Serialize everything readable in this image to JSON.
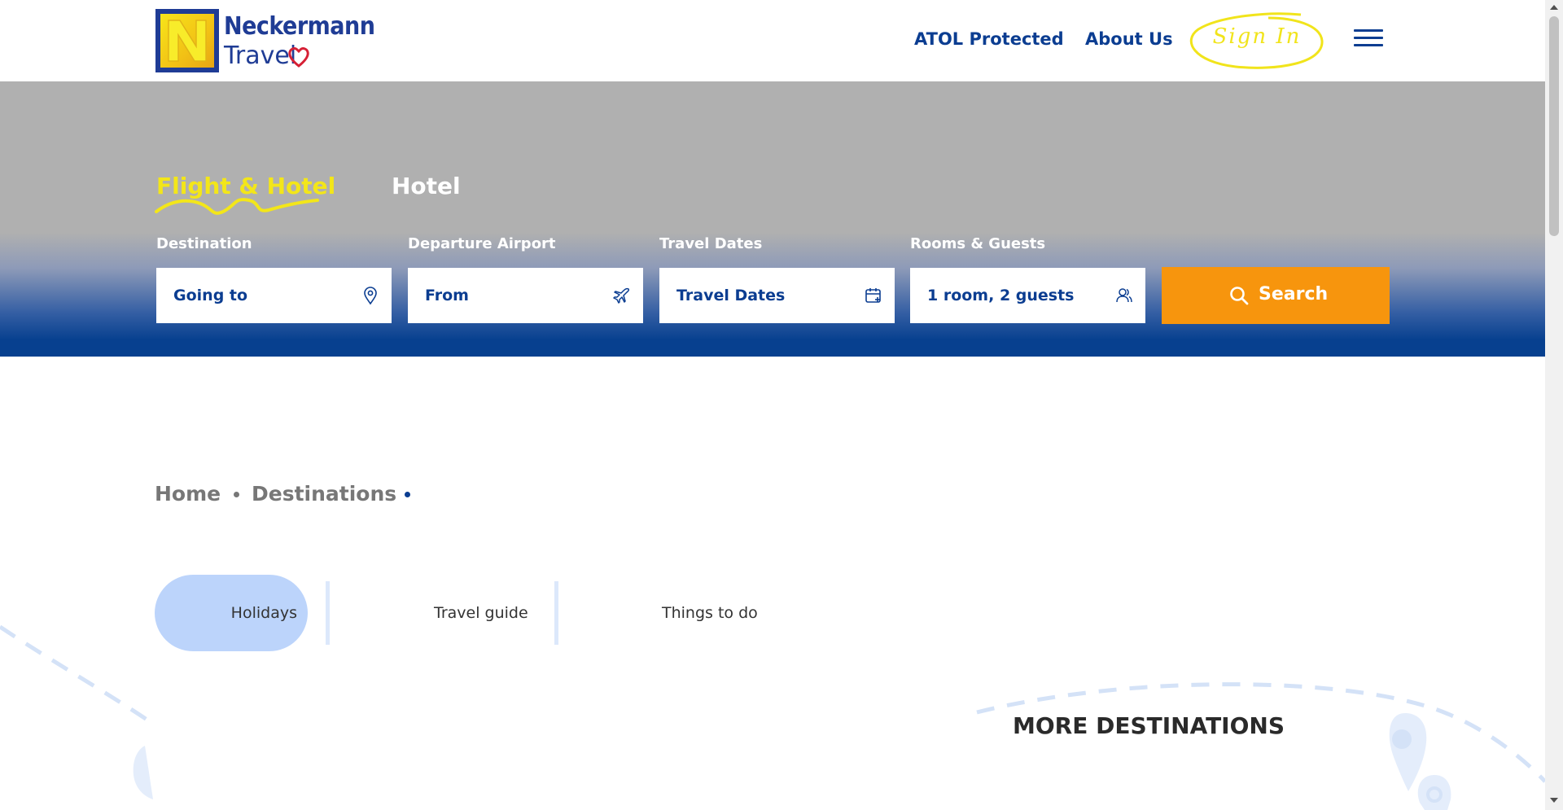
{
  "header": {
    "logo": {
      "line1": "Neckermann",
      "line2": "Travel"
    },
    "nav": {
      "atol": "ATOL Protected",
      "about": "About Us",
      "signin": "Sign In"
    }
  },
  "search": {
    "tabs": {
      "flight_hotel": "Flight & Hotel",
      "hotel": "Hotel"
    },
    "fields": {
      "destination": {
        "label": "Destination",
        "value": "Going to",
        "icon": "location-pin-icon"
      },
      "departure": {
        "label": "Departure Airport",
        "value": "From",
        "icon": "plane-icon"
      },
      "dates": {
        "label": "Travel Dates",
        "value": "Travel Dates",
        "icon": "calendar-icon"
      },
      "guests": {
        "label": "Rooms & Guests",
        "value": "1 room, 2 guests",
        "icon": "guests-icon"
      }
    },
    "button": "Search"
  },
  "breadcrumb": {
    "home": "Home",
    "destinations": "Destinations"
  },
  "content_tabs": {
    "holidays": "Holidays",
    "travel_guide": "Travel guide",
    "things_to_do": "Things to do"
  },
  "more_destinations": "MORE DESTINATIONS",
  "colors": {
    "brand_blue": "#0b3d91",
    "accent_yellow": "#f3e619",
    "search_orange": "#f7950d",
    "pill_blue": "#bcd4fb"
  }
}
